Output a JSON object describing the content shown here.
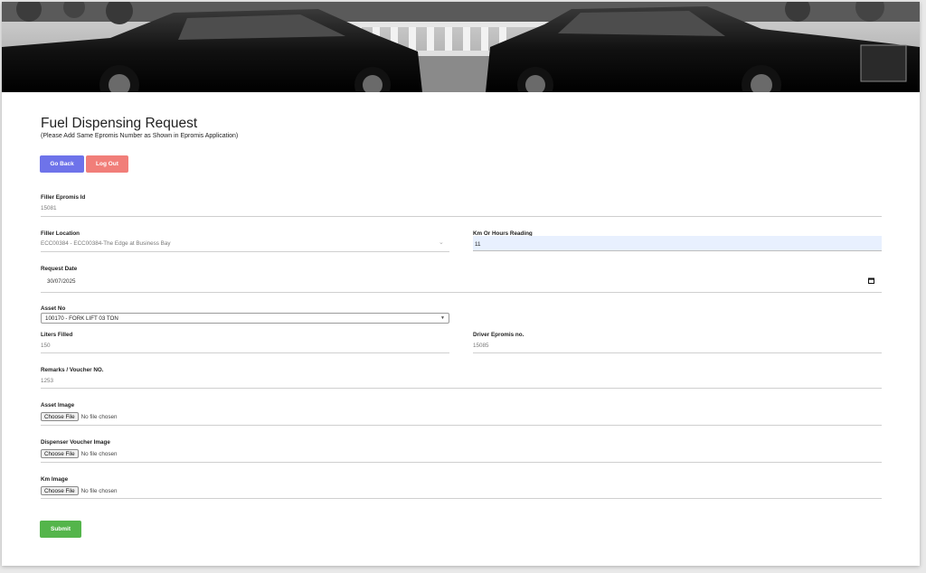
{
  "page": {
    "title": "Fuel Dispensing Request",
    "subtitle": "(Please Add Same Epromis Number as Shown in Epromis Application)"
  },
  "buttons": {
    "go_back": "Go Back",
    "log_out": "Log Out",
    "submit": "Submit"
  },
  "colors": {
    "go_back": "#6e73ea",
    "log_out": "#f17e79",
    "submit": "#54b54b",
    "autofill": "#e8f0fe"
  },
  "form": {
    "filler_epromis_id": {
      "label": "Filler Epromis Id",
      "value": "15081"
    },
    "filler_location": {
      "label": "Filler Location",
      "value": "ECC00384 - ECC00384-The Edge at Business Bay"
    },
    "km_or_hours": {
      "label": "Km Or Hours Reading",
      "value": "11"
    },
    "request_date": {
      "label": "Request Date",
      "value": "30/07/2025"
    },
    "asset_no": {
      "label": "Asset No",
      "value": "100170 - FORK LIFT 03 TON"
    },
    "liters_filled": {
      "label": "Liters Filled",
      "value": "150"
    },
    "driver_epromis": {
      "label": "Driver Epromis no.",
      "value": "15085"
    },
    "remarks": {
      "label": "Remarks / Voucher NO.",
      "value": "1253"
    },
    "asset_image": {
      "label": "Asset Image",
      "button": "Choose File",
      "status": "No file chosen"
    },
    "dispenser_voucher_image": {
      "label": "Dispenser Voucher Image",
      "button": "Choose File",
      "status": "No file chosen"
    },
    "km_image": {
      "label": "Km Image",
      "button": "Choose File",
      "status": "No file chosen"
    }
  },
  "icons": {
    "date_picker": "calendar-icon",
    "location_dropdown": "chevron-down-icon",
    "asset_dropdown": "caret-down-icon"
  }
}
